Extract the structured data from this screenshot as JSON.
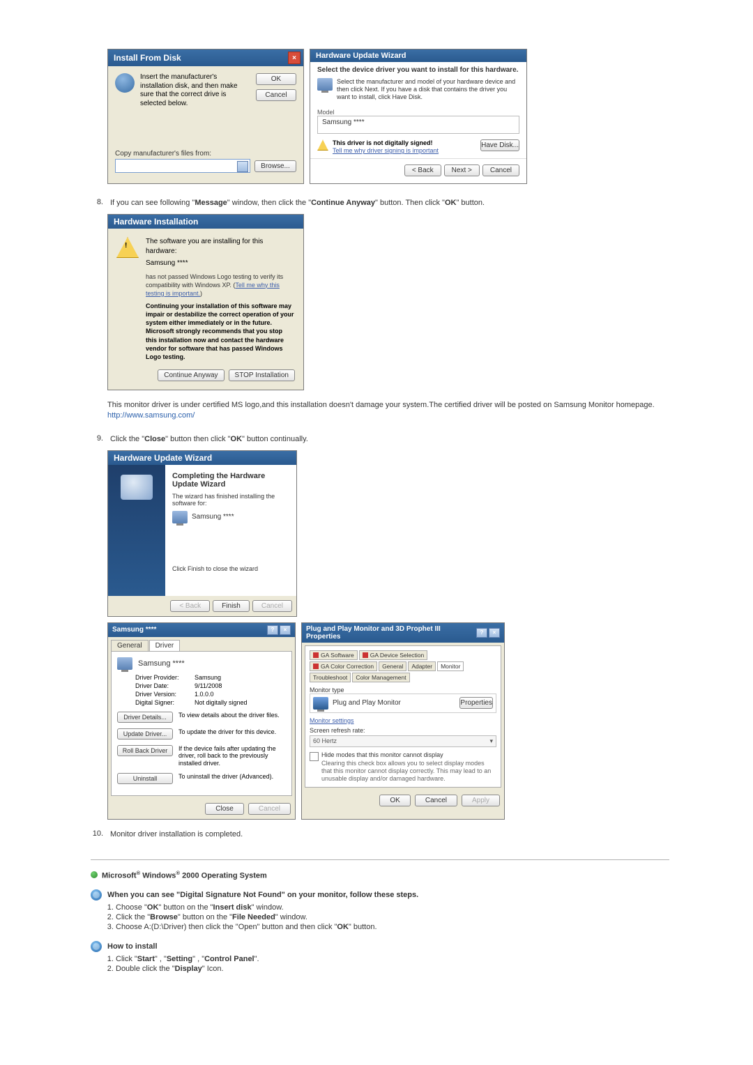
{
  "ifd": {
    "title": "Install From Disk",
    "text": "Insert the manufacturer's installation disk, and then make sure that the correct drive is selected below.",
    "ok": "OK",
    "cancel": "Cancel",
    "copy_label": "Copy manufacturer's files from:",
    "browse": "Browse..."
  },
  "huw": {
    "title": "Hardware Update Wizard",
    "sub": "Select the device driver you want to install for this hardware.",
    "note": "Select the manufacturer and model of your hardware device and then click Next. If you have a disk that contains the driver you want to install, click Have Disk.",
    "model_label": "Model",
    "model_value": "Samsung ****",
    "warn_bold": "This driver is not digitally signed!",
    "warn_link": "Tell me why driver signing is important",
    "have_disk": "Have Disk...",
    "back": "< Back",
    "next": "Next >",
    "cancel": "Cancel"
  },
  "step8": {
    "num": "8.",
    "text_a": "If you can see following \"",
    "message": "Message",
    "text_b": "\" window, then click the \"",
    "continue_anyway": "Continue Anyway",
    "text_c": "\" button. Then click \"",
    "ok": "OK",
    "text_d": "\" button."
  },
  "hi": {
    "title": "Hardware Installation",
    "line1": "The software you are installing for this hardware:",
    "product": "Samsung ****",
    "line2_a": "has not passed Windows Logo testing to verify its compatibility with Windows XP. (",
    "line2_link": "Tell me why this testing is important.",
    "line2_b": ")",
    "bold": "Continuing your installation of this software may impair or destabilize the correct operation of your system either immediately or in the future. Microsoft strongly recommends that you stop this installation now and contact the hardware vendor for software that has passed Windows Logo testing.",
    "continue": "Continue Anyway",
    "stop": "STOP Installation"
  },
  "note_block": {
    "line1": "This monitor driver is under certified MS logo,and this installation doesn't damage your system.The certified driver will be posted on Samsung Monitor homepage.",
    "url": "http://www.samsung.com/"
  },
  "step9": {
    "num": "9.",
    "a": "Click the \"",
    "close": "Close",
    "b": "\" button then click \"",
    "ok": "OK",
    "c": "\" button continually."
  },
  "cw": {
    "title": "Hardware Update Wizard",
    "heading": "Completing the Hardware Update Wizard",
    "line1": "The wizard has finished installing the software for:",
    "product": "Samsung ****",
    "finish_note": "Click Finish to close the wizard",
    "back": "< Back",
    "finish": "Finish",
    "cancel": "Cancel"
  },
  "prop": {
    "title": "Samsung ****",
    "tab_general": "General",
    "tab_driver": "Driver",
    "product": "Samsung ****",
    "kv": {
      "provider_k": "Driver Provider:",
      "provider_v": "Samsung",
      "date_k": "Driver Date:",
      "date_v": "9/11/2008",
      "version_k": "Driver Version:",
      "version_v": "1.0.0.0",
      "signer_k": "Digital Signer:",
      "signer_v": "Not digitally signed"
    },
    "btns": {
      "details_l": "Driver Details...",
      "details_d": "To view details about the driver files.",
      "update_l": "Update Driver...",
      "update_d": "To update the driver for this device.",
      "rollback_l": "Roll Back Driver",
      "rollback_d": "If the device fails after updating the driver, roll back to the previously installed driver.",
      "uninstall_l": "Uninstall",
      "uninstall_d": "To uninstall the driver (Advanced)."
    },
    "close": "Close",
    "cancel": "Cancel"
  },
  "prophet": {
    "title": "Plug and Play Monitor and 3D Prophet III Properties",
    "tabs": {
      "software": "GA Software",
      "device": "GA Device Selection",
      "color": "GA Color Correction",
      "general": "General",
      "adapter": "Adapter",
      "monitor": "Monitor",
      "trouble": "Troubleshoot",
      "cm": "Color Management"
    },
    "monitor_type": "Monitor type",
    "pp": "Plug and Play Monitor",
    "properties": "Properties",
    "settings": "Monitor settings",
    "refresh_label": "Screen refresh rate:",
    "refresh": "60 Hertz",
    "chk_text": "Hide modes that this monitor cannot display",
    "chk_note": "Clearing this check box allows you to select display modes that this monitor cannot display correctly. This may lead to an unusable display and/or damaged hardware.",
    "ok": "OK",
    "cancel": "Cancel",
    "apply": "Apply"
  },
  "step10": {
    "num": "10.",
    "text": "Monitor driver installation is completed."
  },
  "os_head": "Microsoft® Windows® 2000 Operating System",
  "sig_head": "When you can see \"Digital Signature Not Found\" on your monitor, follow these steps.",
  "sig_steps": {
    "s1_a": "Choose \"",
    "s1_ok": "OK",
    "s1_b": "\" button on the \"",
    "s1_insert": "Insert disk",
    "s1_c": "\" window.",
    "s2_a": "Click the \"",
    "s2_browse": "Browse",
    "s2_b": "\" button on the \"",
    "s2_file": "File Needed",
    "s2_c": "\" window.",
    "s3_a": "Choose A:(D:\\Driver) then click the \"Open\" button and then click \"",
    "s3_ok": "OK",
    "s3_b": "\" button."
  },
  "howto_head": "How to install",
  "howto_steps": {
    "s1_a": "Click \"",
    "s1_start": "Start",
    "s1_b": "\" , \"",
    "s1_setting": "Setting",
    "s1_c": "\" , \"",
    "s1_cp": "Control Panel",
    "s1_d": "\".",
    "s2_a": "Double click the \"",
    "s2_display": "Display",
    "s2_b": "\" Icon."
  }
}
